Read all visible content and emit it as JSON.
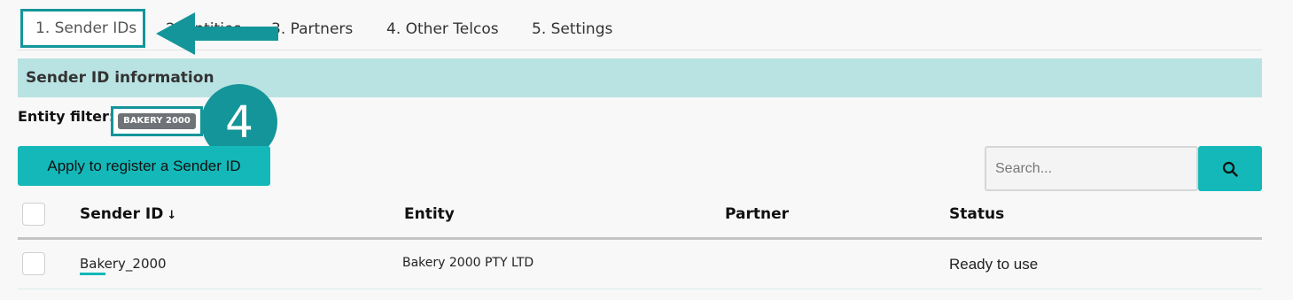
{
  "tabs": [
    {
      "label": "1. Sender IDs"
    },
    {
      "label": "2. Entities"
    },
    {
      "label": "3. Partners"
    },
    {
      "label": "4. Other Telcos"
    },
    {
      "label": "5. Settings"
    }
  ],
  "section": {
    "title": "Sender ID information"
  },
  "filter": {
    "label": "Entity filter:",
    "tag": "BAKERY 2000"
  },
  "annotation": {
    "step_number": "4"
  },
  "actions": {
    "apply_label": "Apply to register a Sender ID"
  },
  "search": {
    "placeholder": "Search...",
    "value": ""
  },
  "table": {
    "columns": [
      "Sender ID",
      "Entity",
      "Partner",
      "Status"
    ],
    "sort_indicator": "↓",
    "rows": [
      {
        "sender_id": "Bakery_2000",
        "entity": "Bakery 2000 PTY LTD",
        "partner": "",
        "status": "Ready to use"
      }
    ]
  },
  "colors": {
    "accent": "#14b8b8",
    "annotation": "#14959a",
    "section_bg": "#b9e3e2"
  }
}
